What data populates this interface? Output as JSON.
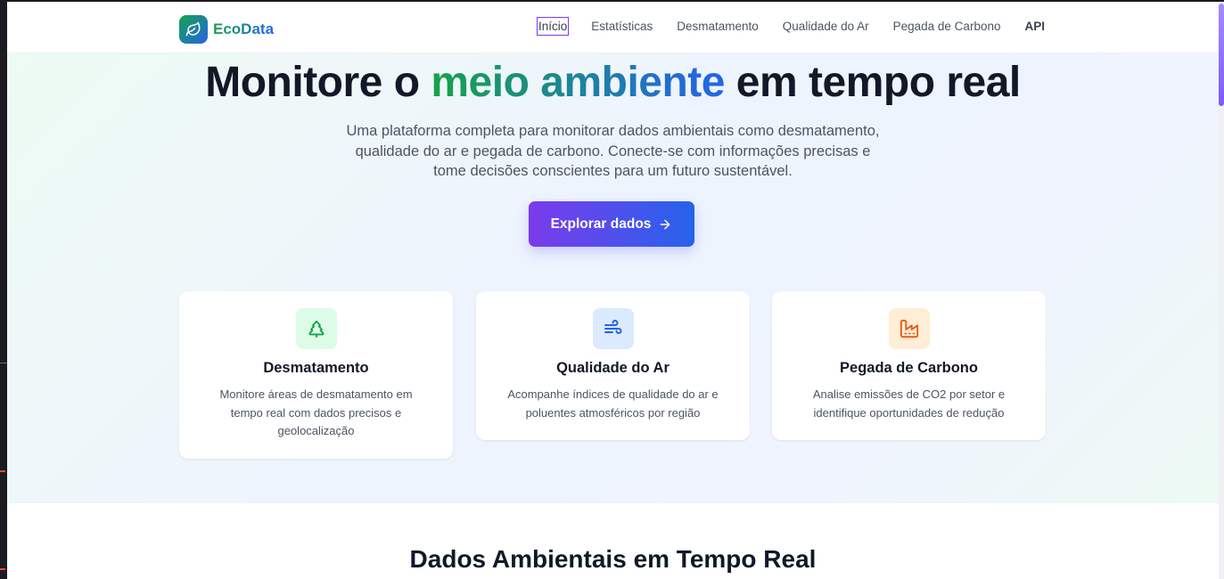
{
  "brand": {
    "name": "EcoData",
    "logo_icon": "leaf-icon"
  },
  "nav": {
    "items": [
      {
        "label": "Início",
        "active": true
      },
      {
        "label": "Estatísticas",
        "active": false
      },
      {
        "label": "Desmatamento",
        "active": false
      },
      {
        "label": "Qualidade do Ar",
        "active": false
      },
      {
        "label": "Pegada de Carbono",
        "active": false
      },
      {
        "label": "API",
        "active": false
      }
    ]
  },
  "hero": {
    "title_start": "Monitore o ",
    "title_highlight": "meio ambiente",
    "title_end": " em tempo real",
    "subtitle": "Uma plataforma completa para monitorar dados ambientais como desmatamento, qualidade do ar e pegada de carbono. Conecte-se com informações precisas e tome decisões conscientes para um futuro sustentável.",
    "cta_label": "Explorar dados",
    "cta_icon": "arrow-right-icon"
  },
  "features": [
    {
      "title": "Desmatamento",
      "description": "Monitore áreas de desmatamento em tempo real com dados precisos e geolocalização",
      "icon": "tree-icon",
      "icon_color": "#16a34a",
      "icon_bg": "#dcfce7"
    },
    {
      "title": "Qualidade do Ar",
      "description": "Acompanhe índices de qualidade do ar e poluentes atmosféricos por região",
      "icon": "wind-icon",
      "icon_color": "#2563eb",
      "icon_bg": "#dbeafe"
    },
    {
      "title": "Pegada de Carbono",
      "description": "Analise emissões de CO2 por setor e identifique oportunidades de redução",
      "icon": "factory-icon",
      "icon_color": "#ea580c",
      "icon_bg": "#ffedd5"
    }
  ],
  "section": {
    "title": "Dados Ambientais em Tempo Real"
  },
  "colors": {
    "brand_green": "#16a34a",
    "brand_blue": "#2563eb",
    "cta_purple": "#7c3aed",
    "heading": "#111827"
  }
}
